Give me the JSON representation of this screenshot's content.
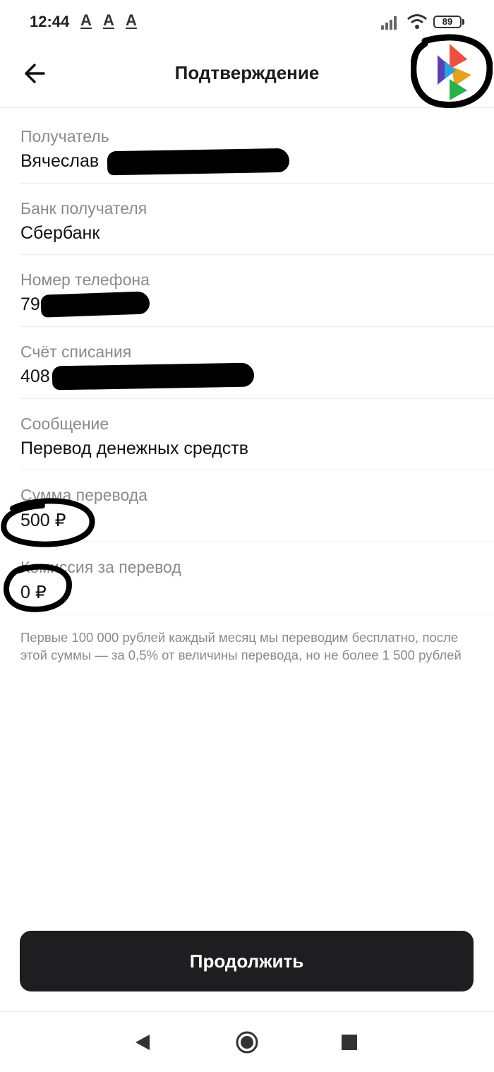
{
  "status_bar": {
    "time": "12:44",
    "indicators": [
      "A",
      "A",
      "A"
    ],
    "battery": "89"
  },
  "header": {
    "title": "Подтверждение",
    "back_icon": "arrow-left-icon",
    "logo_icon": "bank-logo-icon"
  },
  "details": [
    {
      "label": "Получатель",
      "value": "Вячеслав"
    },
    {
      "label": "Банк получателя",
      "value": "Сбербанк"
    },
    {
      "label": "Номер телефона",
      "value": "79"
    },
    {
      "label": "Счёт списания",
      "value": "408"
    },
    {
      "label": "Сообщение",
      "value": "Перевод денежных средств"
    },
    {
      "label": "Сумма перевода",
      "value": "500 ₽"
    },
    {
      "label": "Комиссия за перевод",
      "value": "0 ₽"
    }
  ],
  "note": "Первые 100 000 рублей каждый месяц мы переводим бесплатно, после этой суммы — за 0,5% от величины перевода, но не более 1 500 рублей",
  "continue_label": "Продолжить",
  "colors": {
    "button_bg": "#1e1e20",
    "label": "#8a8a8e",
    "text": "#111111"
  }
}
